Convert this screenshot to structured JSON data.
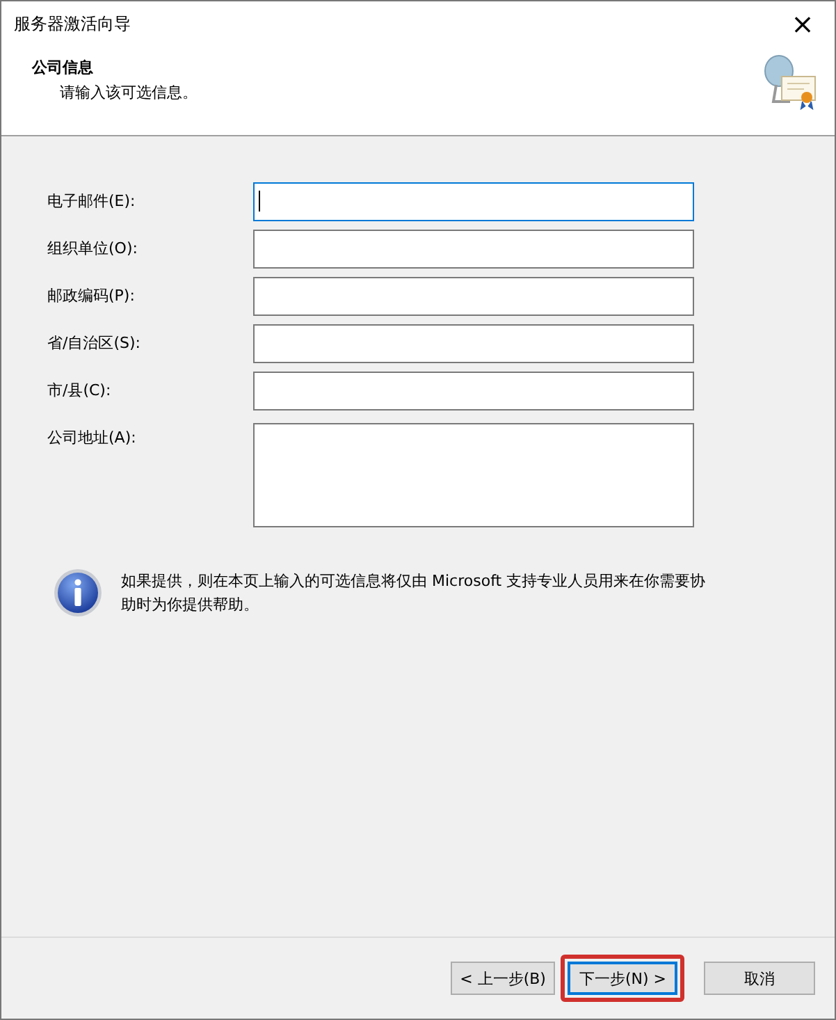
{
  "window": {
    "title": "服务器激活向导",
    "close": "×"
  },
  "header": {
    "title": "公司信息",
    "subtitle": "请输入该可选信息。"
  },
  "fields": [
    {
      "label": "电子邮件(E):",
      "kind": "line",
      "focused": true
    },
    {
      "label": "组织单位(O):",
      "kind": "line",
      "focused": false
    },
    {
      "label": "邮政编码(P):",
      "kind": "line",
      "focused": false
    },
    {
      "label": "省/自治区(S):",
      "kind": "line",
      "focused": false
    },
    {
      "label": "市/县(C):",
      "kind": "line",
      "focused": false
    },
    {
      "label": "公司地址(A):",
      "kind": "multiline",
      "focused": false
    }
  ],
  "info": "如果提供，则在本页上输入的可选信息将仅由 Microsoft 支持专业人员用来在你需要协助时为你提供帮助。",
  "buttons": [
    {
      "label": "< 上一步(B)",
      "default": false,
      "highlighted": false
    },
    {
      "label": "下一步(N) >",
      "default": true,
      "highlighted": true
    },
    {
      "label": "取消",
      "default": false,
      "highlighted": false
    }
  ]
}
